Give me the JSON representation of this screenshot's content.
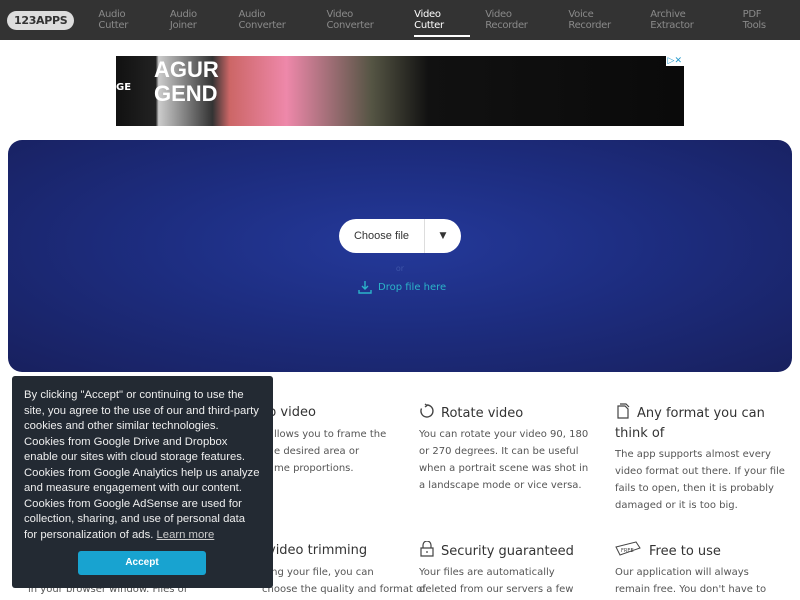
{
  "header": {
    "logo": "123APPS",
    "nav": [
      {
        "label": "Audio Cutter"
      },
      {
        "label": "Audio Joiner"
      },
      {
        "label": "Audio Converter"
      },
      {
        "label": "Video Converter"
      },
      {
        "label": "Video Cutter",
        "active": true
      },
      {
        "label": "Video Recorder"
      },
      {
        "label": "Voice Recorder"
      },
      {
        "label": "Archive Extractor"
      },
      {
        "label": "PDF Tools"
      }
    ]
  },
  "ad": {
    "text1": "AGUR",
    "text2": "GEND",
    "text3": "GE"
  },
  "upload": {
    "choose_label": "Choose file",
    "or": "or",
    "drop_label": "Drop file here",
    "accent": "#2bb3c9"
  },
  "features": [
    {
      "title": "p video",
      "lines": [
        "llows you to frame the",
        "e desired area or",
        "me proportions."
      ]
    },
    {
      "title": "Rotate video",
      "icon": "rotate-icon",
      "text": "You can rotate your video 90, 180 or 270 degrees. It can be useful when a portrait scene was shot in a landscape mode or vice versa."
    },
    {
      "title": "Any format you can think of",
      "icon": "file-icon",
      "text": "The app supports almost every video format out there. If your file fails to open, then it is probably damaged or it is too big."
    },
    {
      "title": "video trimming",
      "lines": [
        "ding your file, you can",
        "choose the quality and format of"
      ]
    },
    {
      "title": "Security guaranteed",
      "icon": "lock-icon",
      "text": "Your files are automatically deleted from our servers a few"
    },
    {
      "title": "Free to use",
      "icon": "free-tag-icon",
      "text": "Our application will always remain free. You don't have to"
    },
    {
      "text": "in your browser window. Files of"
    }
  ],
  "cookie": {
    "text": "By clicking \"Accept\" or continuing to use the site, you agree to the use of our and third-party cookies and other similar technologies. Cookies from Google Drive and Dropbox enable our sites with cloud storage features. Cookies from Google Analytics help us analyze and measure engagement with our content. Cookies from Google AdSense are used for collection, sharing, and use of personal data for personalization of ads.",
    "learn_more": "Learn more",
    "accept": "Accept"
  }
}
